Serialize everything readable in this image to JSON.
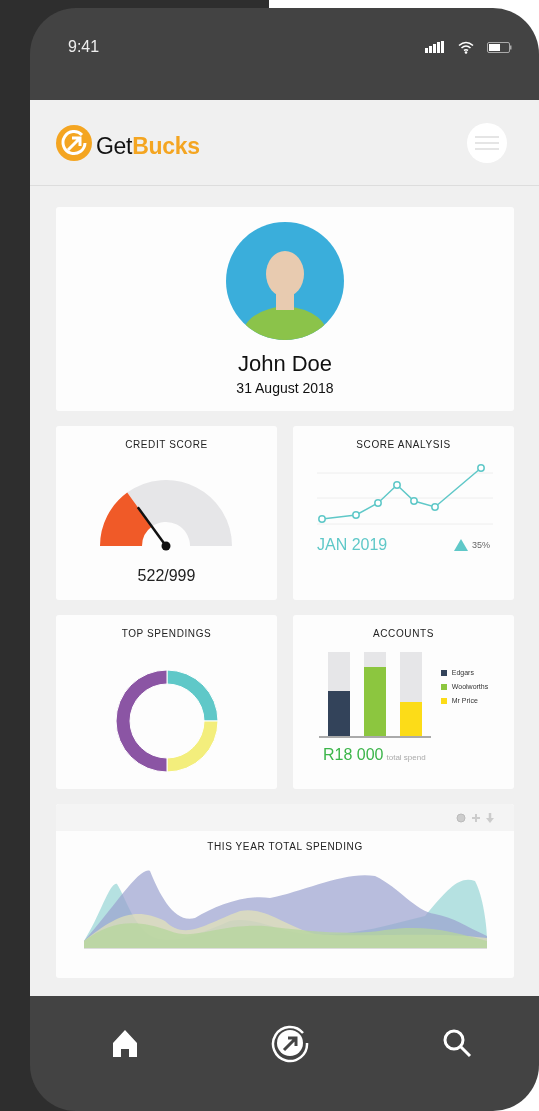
{
  "status_bar": {
    "time": "9:41"
  },
  "header": {
    "logo": [
      "Get",
      "Bucks"
    ]
  },
  "profile": {
    "name": "John Doe",
    "date": "31 August 2018"
  },
  "credit_score": {
    "title": "CREDIT SCORE",
    "score": "522/999"
  },
  "score_analysis": {
    "title": "SCORE ANALYSIS",
    "period": "JAN 2019",
    "change": "35%"
  },
  "top_spendings": {
    "title": "TOP SPENDINGS"
  },
  "accounts": {
    "title": "ACCOUNTS",
    "items": [
      {
        "name": "Edgars",
        "color": "#33435a"
      },
      {
        "name": "Woolworths",
        "color": "#8cc63f"
      },
      {
        "name": "Mr Price",
        "color": "#fcdc18"
      }
    ],
    "total": "R18 000",
    "total_label": "total spend"
  },
  "spending": {
    "title": "THIS YEAR TOTAL SPENDING"
  }
}
